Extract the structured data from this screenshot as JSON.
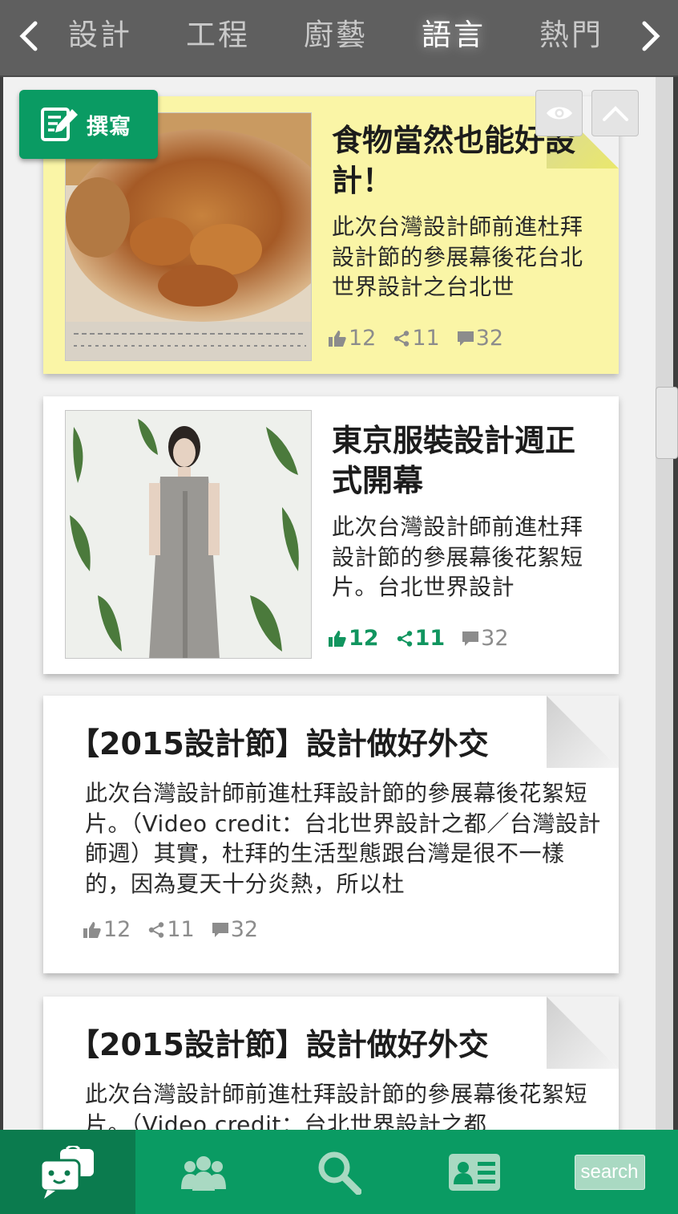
{
  "topbar": {
    "prev_label": "<",
    "next_label": ">",
    "categories": [
      "設計",
      "工程",
      "廚藝",
      "語言",
      "熱門"
    ],
    "active_index": 3
  },
  "compose": {
    "label": "撰寫",
    "icon": "edit-icon"
  },
  "actions": {
    "eye_icon": "eye-icon",
    "up_icon": "chevron-up-icon"
  },
  "cards": [
    {
      "title": "食物當然也能好設計！",
      "excerpt": "此次台灣設計師前進杜拜設計節的參展幕後花台北世界設計之台北世",
      "likes": "12",
      "shares": "11",
      "comments": "32",
      "highlighted": false,
      "image": "apple-pie-photo"
    },
    {
      "title": "東京服裝設計週正式開幕",
      "excerpt": "此次台灣設計師前進杜拜設計節的參展幕後花絮短片。台北世界設計",
      "likes": "12",
      "shares": "11",
      "comments": "32",
      "highlighted": true,
      "image": "fashion-model-photo"
    },
    {
      "title": "【2015設計節】設計做好外交",
      "excerpt": "此次台灣設計師前進杜拜設計節的參展幕後花絮短片。（Video credit：台北世界設計之都／台灣設計師週）其實，杜拜的生活型態跟台灣是很不一樣的，因為夏天十分炎熱，所以杜",
      "likes": "12",
      "shares": "11",
      "comments": "32"
    },
    {
      "title": "【2015設計節】設計做好外交",
      "excerpt": "此次台灣設計師前進杜拜設計節的參展幕後花絮短片。（Video credit：台北世界設計之都"
    }
  ],
  "bottomnav": {
    "tabs": [
      "chat-icon",
      "group-icon",
      "search-icon",
      "contact-card-icon"
    ],
    "search_label": "search",
    "active_index": 0
  },
  "colors": {
    "brand_green": "#0a9b63",
    "active_green": "#0b7b4e",
    "highlight_yellow": "#faf5a6",
    "topbar_gray": "#5f5f5f"
  }
}
